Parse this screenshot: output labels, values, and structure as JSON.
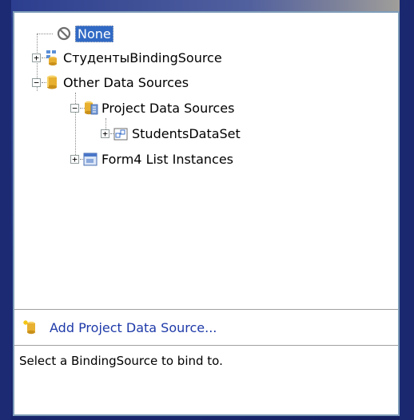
{
  "tree": {
    "items": [
      {
        "label": "None",
        "icon": "none-circle-slash-icon",
        "selected": true
      },
      {
        "label": "СтудентыBindingSource",
        "icon": "binding-source-icon",
        "expander": "+"
      },
      {
        "label": "Other Data Sources",
        "icon": "database-folder-icon",
        "expander": "−"
      },
      {
        "label": "Project Data Sources",
        "icon": "project-data-sources-icon",
        "expander": "−"
      },
      {
        "label": "StudentsDataSet",
        "icon": "dataset-icon",
        "expander": "+"
      },
      {
        "label": "Form4 List Instances",
        "icon": "form-list-icon",
        "expander": "+"
      }
    ]
  },
  "footer": {
    "add_label": "Add Project Data Source...",
    "description": "Select a BindingSource to bind to."
  },
  "colors": {
    "selection": "#316ac5",
    "link": "#1e3aa8",
    "border": "#7f9db9"
  }
}
